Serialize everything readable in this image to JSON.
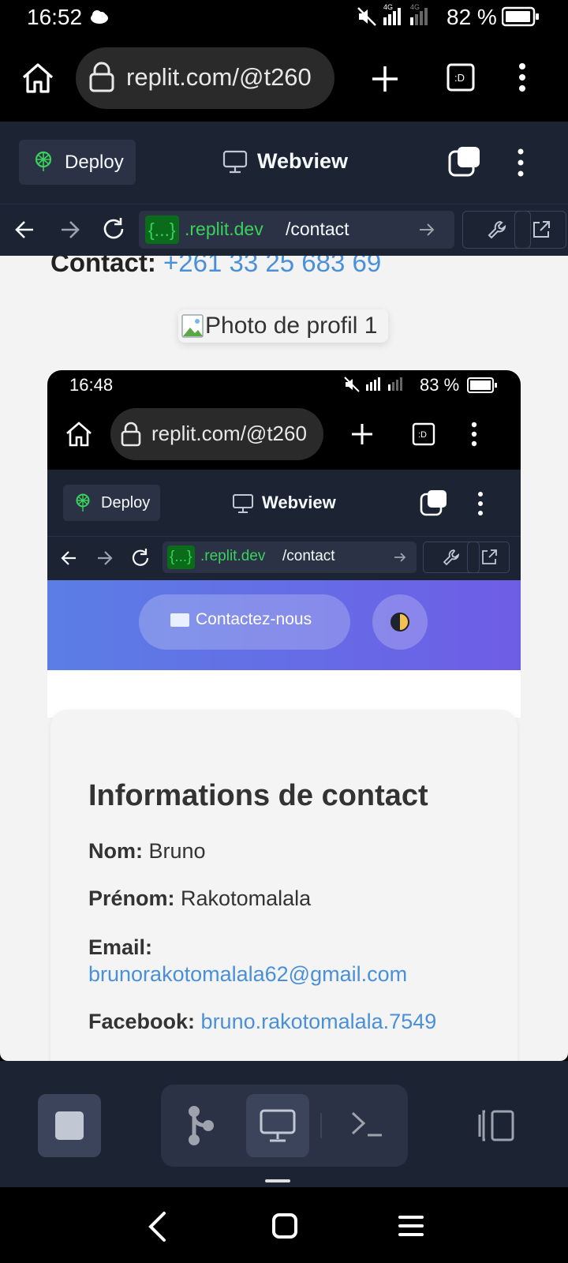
{
  "status_bar": {
    "time": "16:52",
    "battery": "82 %"
  },
  "browser": {
    "url": "replit.com/@t260"
  },
  "replit": {
    "deploy_label": "Deploy",
    "webview_title": "Webview",
    "url_badge": "{...}",
    "url_host": ".replit.dev",
    "url_path": "/contact"
  },
  "page": {
    "contact_label": "Contact:",
    "contact_phone": "+261 33 25 683 69",
    "profile_alt": "Photo de profil 1"
  },
  "embedded": {
    "status_time": "16:48",
    "battery": "83 %",
    "url": "replit.com/@t260",
    "deploy_label": "Deploy",
    "webview_title": "Webview",
    "url_badge": "{...}",
    "url_host": ".replit.dev",
    "url_path": "/contact",
    "contact_button": "Contactez-nous",
    "section_title": "Informations de contact",
    "fields": {
      "nom_label": "Nom:",
      "nom_value": "Bruno",
      "prenom_label": "Prénom:",
      "prenom_value": "Rakotomalala",
      "email_label": "Email:",
      "email_value": "brunorakotomalala62@gmail.com",
      "facebook_label": "Facebook:",
      "facebook_value": "bruno.rakotomalala.7549"
    }
  },
  "colors": {
    "replit_bg": "#1c2333",
    "link": "#4a90d9",
    "hero_start": "#5b7ee5",
    "hero_end": "#6e5de6",
    "url_green": "#3ad15b"
  },
  "icons": [
    "cloud-icon",
    "mute-icon",
    "signal-icon",
    "battery-icon",
    "home-icon",
    "lock-icon",
    "plus-icon",
    "tab-switcher-icon",
    "kebab-menu-icon",
    "deploy-icon",
    "monitor-icon",
    "stack-icon",
    "back-arrow-icon",
    "forward-arrow-icon",
    "reload-icon",
    "go-arrow-icon",
    "wrench-icon",
    "external-link-icon",
    "broken-image-icon",
    "mail-icon",
    "theme-toggle-icon",
    "stop-icon",
    "git-icon",
    "terminal-icon",
    "layout-icon",
    "nav-back-icon",
    "nav-home-icon",
    "nav-menu-icon"
  ]
}
